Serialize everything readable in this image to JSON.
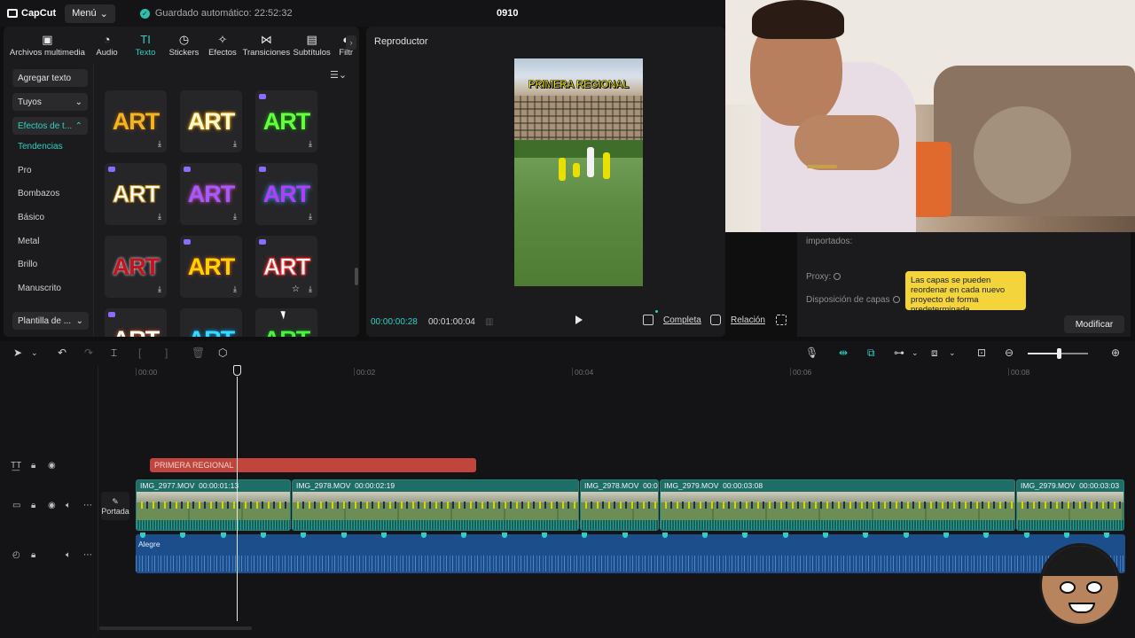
{
  "app": {
    "name": "CapCut",
    "menu_label": "Menú",
    "autosave": "Guardado automático: 22:52:32",
    "project_title": "0910"
  },
  "toolbar": {
    "tabs": [
      {
        "label": "Archivos multimedia",
        "icon": "media-icon"
      },
      {
        "label": "Audio",
        "icon": "audio-icon"
      },
      {
        "label": "Texto",
        "icon": "text-icon",
        "active": true
      },
      {
        "label": "Stickers",
        "icon": "sticker-icon"
      },
      {
        "label": "Efectos",
        "icon": "effects-icon"
      },
      {
        "label": "Transiciones",
        "icon": "transitions-icon"
      },
      {
        "label": "Subtítulos",
        "icon": "subtitles-icon"
      },
      {
        "label": "Filtr",
        "icon": "filters-icon"
      }
    ]
  },
  "sidebar": {
    "add_text": "Agregar texto",
    "yours": "Tuyos",
    "effects_group": "Efectos de t...",
    "items": [
      "Tendencias",
      "Pro",
      "Bombazos",
      "Básico",
      "Metal",
      "Brillo",
      "Manuscrito"
    ],
    "template": "Plantilla de ..."
  },
  "text_effects": {
    "tiles": [
      {
        "text": "ART",
        "premium": false
      },
      {
        "text": "ART",
        "premium": false
      },
      {
        "text": "ART",
        "premium": true
      },
      {
        "text": "ART",
        "premium": true
      },
      {
        "text": "ART",
        "premium": true
      },
      {
        "text": "ART",
        "premium": true
      },
      {
        "text": "ART",
        "premium": false
      },
      {
        "text": "ART",
        "premium": true
      },
      {
        "text": "ART",
        "premium": true
      },
      {
        "text": "ART",
        "premium": true
      },
      {
        "text": "ART",
        "premium": false
      },
      {
        "text": "ART",
        "premium": false
      }
    ]
  },
  "player": {
    "title": "Reproductor",
    "caption": "PRIMERA REGIONAL",
    "current_time": "00:00:00:28",
    "total_time": "00:01:00:04",
    "full_label": "Completa",
    "ratio_label": "Relación"
  },
  "properties": {
    "imported_label": "importados:",
    "proxy_label": "Proxy:",
    "layers_label": "Disposición de capas",
    "tooltip": "Las capas se pueden reordenar en cada nuevo proyecto de forma predeterminada",
    "modify_button": "Modificar"
  },
  "timeline": {
    "ruler_ticks": [
      "00:00",
      "00:02",
      "00:04",
      "00:06",
      "00:08"
    ],
    "text_clip": "PRIMERA REGIONAL",
    "cover_label": "Portada",
    "video_clips": [
      {
        "name": "IMG_2977.MOV",
        "duration": "00:00:01:13"
      },
      {
        "name": "IMG_2978.MOV",
        "duration": "00:00:02:19"
      },
      {
        "name": "IMG_2978.MOV",
        "duration": "00:0"
      },
      {
        "name": "IMG_2979.MOV",
        "duration": "00:00:03:08"
      },
      {
        "name": "IMG_2979.MOV",
        "duration": "00:00:03:03"
      }
    ],
    "audio_clip": "Alegre",
    "zoom_level": 0.53
  },
  "colors": {
    "accent": "#2fd0c3",
    "text_clip": "#c0453d",
    "video_clip": "#1e6e68",
    "audio_clip": "#1c4e8c",
    "tooltip_bg": "#f3d43b"
  }
}
